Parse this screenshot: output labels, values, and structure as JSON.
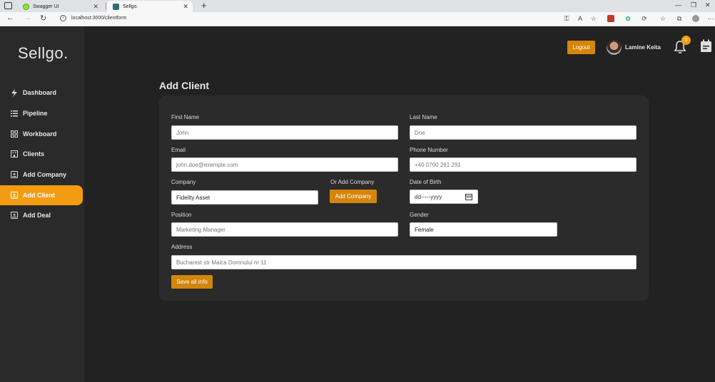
{
  "browser": {
    "tabs": [
      {
        "label": "Swagger UI",
        "color": "#85ea2d"
      },
      {
        "label": "Sellgo.",
        "color": "#2f6f6f"
      }
    ],
    "url": "localhost:3000/clientform"
  },
  "app": {
    "logo": "Sellgo.",
    "accent": "#f39c12",
    "sidebar": [
      {
        "label": "Dashboard",
        "icon": "bolt-icon"
      },
      {
        "label": "Pipeline",
        "icon": "list-icon"
      },
      {
        "label": "Workboard",
        "icon": "grid-icon"
      },
      {
        "label": "Clients",
        "icon": "building-icon"
      },
      {
        "label": "Add Company",
        "icon": "add-box-icon"
      },
      {
        "label": "Add Client",
        "icon": "add-box-icon",
        "active": true
      },
      {
        "label": "Add Deal",
        "icon": "add-box-icon"
      }
    ],
    "header": {
      "logout": "Logout",
      "user": "Lamine Keita",
      "notifications": "0"
    }
  },
  "form": {
    "title": "Add Client",
    "first_name": {
      "label": "First Name",
      "placeholder": "John"
    },
    "last_name": {
      "label": "Last Name",
      "placeholder": "Doe"
    },
    "email": {
      "label": "Email",
      "placeholder": "john.doe@exemple.com"
    },
    "phone": {
      "label": "Phone Number",
      "placeholder": "+40 0700 261 291"
    },
    "company": {
      "label": "Company",
      "value": "Fidelity Asset"
    },
    "or_add_company": {
      "label": "Or Add Company",
      "button": "Add Company"
    },
    "dob": {
      "label": "Date of Birth",
      "placeholder": "dd-----yyyy"
    },
    "position": {
      "label": "Position",
      "placeholder": "Marketing Manager"
    },
    "gender": {
      "label": "Gender",
      "value": "Female"
    },
    "address": {
      "label": "Address",
      "placeholder": "Bucharest str Maica Domnului nr 11"
    },
    "submit": "Save all info"
  }
}
